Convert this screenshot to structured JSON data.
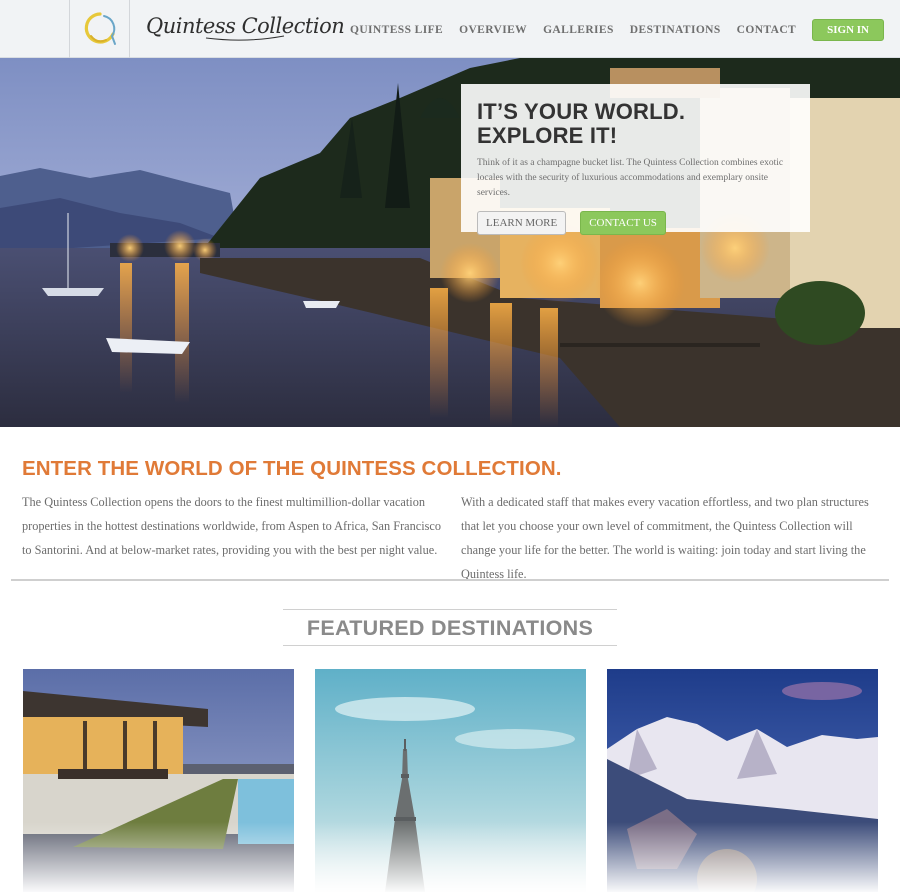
{
  "header": {
    "brand": "Quintess Collection",
    "nav": [
      "QUINTESS LIFE",
      "OVERVIEW",
      "GALLERIES",
      "DESTINATIONS",
      "CONTACT"
    ],
    "sign_in": "SIGN IN"
  },
  "hero": {
    "title_line1": "IT’S YOUR WORLD.",
    "title_line2": "EXPLORE IT!",
    "text": "Think of it as a champagne bucket list. The Quintess Collection combines exotic locales with the security of luxurious accommodations and exemplary onsite services.",
    "learn_more": "LEARN MORE",
    "contact_us": "CONTACT US"
  },
  "intro": {
    "title": "ENTER THE WORLD OF THE QUINTESS COLLECTION.",
    "left": "The Quintess Collection opens the doors to the finest multimillion-dollar vacation properties in the hottest destinations worldwide, from Aspen to Africa, San Francisco to Santorini. And at below-market rates, providing you with the best per night value.",
    "right": "With a dedicated staff that makes every vacation effortless, and two plan structures that let you choose your own level of commitment, the Quintess Collection will change your life for the better. The world is waiting: join today and start living the Quintess life."
  },
  "featured": {
    "title": "FEATURED DESTINATIONS"
  },
  "colors": {
    "accent_orange": "#e07a37",
    "button_green": "#8cc85c",
    "header_bg": "#f0f2f5"
  }
}
